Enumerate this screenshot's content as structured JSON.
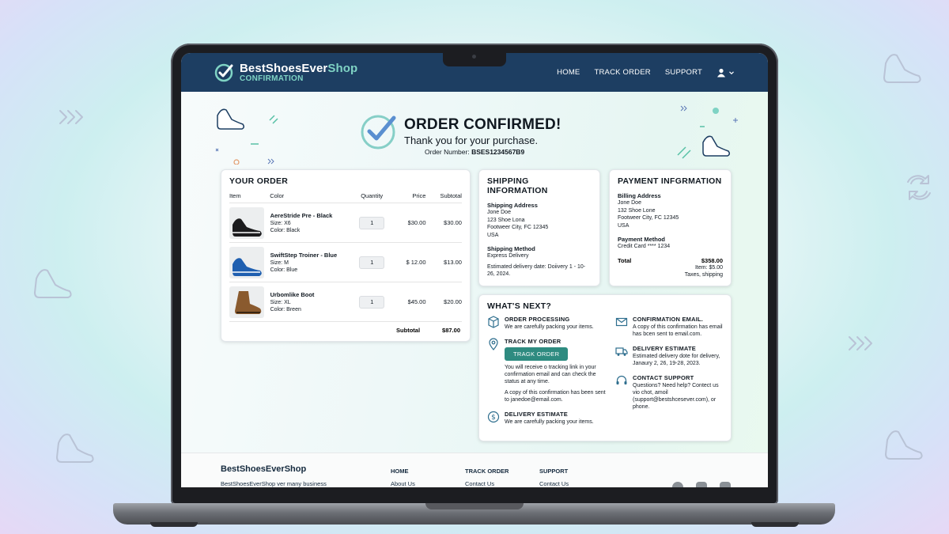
{
  "nav": {
    "brand_prefix": "BestShoesEver",
    "brand_suffix": "Shop",
    "brand_sub": "CONFIRMATION",
    "links": [
      "HOME",
      "TRACK ORDER",
      "SUPPORT"
    ],
    "user_icon": "user-icon"
  },
  "confirmation": {
    "title": "ORDER CONFIRMED!",
    "subtitle": "Thank you for your purchase.",
    "order_label": "Order Number:",
    "order_number": "BSES1234567B9"
  },
  "order": {
    "title": "YOUR ORDER",
    "headers": {
      "item": "Item",
      "color": "Color",
      "quantity": "Quantity",
      "price": "Price",
      "subtotal": "Subtotal"
    },
    "items": [
      {
        "name": "AereStride Pre - Black",
        "size": "Size: X6",
        "color": "Color: Black",
        "qty": "1",
        "price": "$30.00",
        "subtotal": "$30.00",
        "shoe_color": "#1c1c1e"
      },
      {
        "name": "SwiftStep Troiner - Blue",
        "size": "Size: M",
        "color": "Color: Blue",
        "qty": "1",
        "price": "$ 12.00",
        "subtotal": "$13.00",
        "shoe_color": "#1f5fb0"
      },
      {
        "name": "Urbomlike Boot",
        "size": "Size: XL",
        "color": "Color: Breen",
        "qty": "1",
        "price": "$45.00",
        "subtotal": "$20.00",
        "shoe_color": "#8a5a2e"
      }
    ],
    "subtotal_label": "Subtotal",
    "subtotal_value": "$87.00"
  },
  "shipping": {
    "title": "SHIPPING INFORMATION",
    "address_label": "Shipping Address",
    "address_lines": [
      "Jone Doe",
      "123 Shoe Lona",
      "Footweer City, FC 12345",
      "USA"
    ],
    "method_label": "Shipping Method",
    "method": "Express Delivery",
    "estimate": "Estimated delivery date: Doiivery 1 - 10-26, 2024."
  },
  "payment": {
    "title": "PAYMENT INFGRMATION",
    "billing_label": "Billing Address",
    "billing_lines": [
      "Jone Doe",
      "132 Shoe Lone",
      "Footweer City, FC 12345",
      "USA"
    ],
    "method_label": "Payment Method",
    "method": "Credit Card **** 1234",
    "total_label": "Total",
    "total_value": "$358.00",
    "item_line": "Item: $5.00",
    "tax_line": "Taxes, shipping"
  },
  "whats_next": {
    "title": "WHAT'S NEXT?",
    "left": [
      {
        "icon": "box-icon",
        "title": "ORDER PROCESSING",
        "text": "We are carefully packing your items."
      },
      {
        "icon": "location-pin-icon",
        "title": "TRACK MY ORDER",
        "button": "TRAGK ORDER",
        "text": "You will receive o tracking link in your confirmation email and can check the status at any time.",
        "text2": "A copy of this confirmation has been sent to janedoe@email.com."
      },
      {
        "icon": "dollar-icon",
        "title": "DELIVERY ESTIMATE",
        "text": "We are carefully packing your items."
      }
    ],
    "right": [
      {
        "icon": "envelope-icon",
        "title": "CONFIRMATION EMAIL.",
        "text": "A copy of this confirmation has email has bcen sent to email.com."
      },
      {
        "icon": "truck-icon",
        "title": "DELIVERY ESTIMATE",
        "text": "Estimated delivery dote for delivery, Janaury 2, 26, 19-28, 2023."
      },
      {
        "icon": "headset-icon",
        "title": "CONTACT SUPPORT",
        "text": "Questions? Need help? Contect us vio chot, amoil (support@bestshcesever.com), or phone."
      }
    ]
  },
  "footer": {
    "brand": "BestShoesEverShop",
    "desc": "BestShoesEverShop ver many business",
    "cols": [
      {
        "heading": "HOME",
        "link": "About Us"
      },
      {
        "heading": "TRACK ORDER",
        "link": "Contact Us"
      },
      {
        "heading": "SUPPORT",
        "link": "Contact Us"
      }
    ],
    "social": [
      "facebook-icon",
      "instagram-icon",
      "youtube-icon"
    ]
  },
  "colors": {
    "nav_bg": "#1d3e62",
    "accent": "#7fd3c4",
    "button": "#2e8b80"
  }
}
